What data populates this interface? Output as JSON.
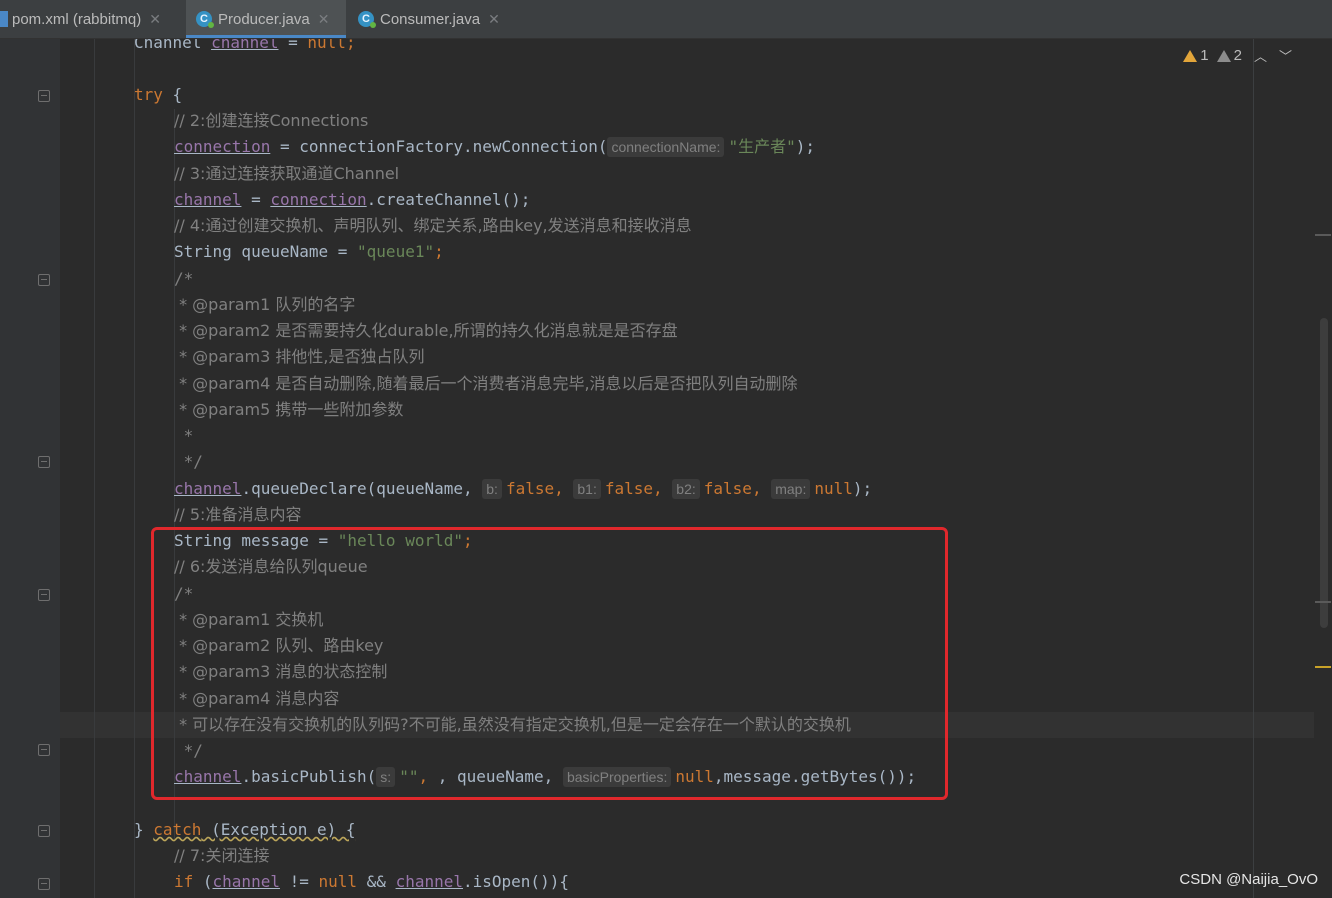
{
  "tabs": [
    {
      "label": "pom.xml (rabbitmq)"
    },
    {
      "label": "Producer.java"
    },
    {
      "label": "Consumer.java"
    }
  ],
  "inspections": {
    "warnings": "1",
    "weak_warnings": "2"
  },
  "code": {
    "l0": {
      "t1": "Channel ",
      "t2": "channel",
      "t3": " = ",
      "t4": "null",
      "t5": ";"
    },
    "l2": {
      "t1": "try",
      "t2": " {"
    },
    "l3": {
      "t1": "// 2:创建连接Connections"
    },
    "l4": {
      "t1": "connection",
      "t2": " = connectionFactory.newConnection(",
      "h1": "connectionName:",
      "t3": "\"生产者\"",
      "t4": ");"
    },
    "l5": {
      "t1": "// 3:通过连接获取通道Channel"
    },
    "l6": {
      "t1": "channel",
      "t2": " = ",
      "t3": "connection",
      "t4": ".createChannel();"
    },
    "l7": {
      "t1": "// 4:通过创建交换机、声明队列、绑定关系,路由key,发送消息和接收消息"
    },
    "l8": {
      "t1": "String queueName = ",
      "t2": "\"queue1\"",
      "t3": ";"
    },
    "l9": {
      "t1": "/*"
    },
    "l10": {
      "t1": " * @param1 队列的名字"
    },
    "l11": {
      "t1": " * @param2 是否需要持久化durable,所谓的持久化消息就是是否存盘"
    },
    "l12": {
      "t1": " * @param3 排他性,是否独占队列"
    },
    "l13": {
      "t1": " * @param4 是否自动删除,随着最后一个消费者消息完毕,消息以后是否把队列自动删除"
    },
    "l14": {
      "t1": " * @param5 携带一些附加参数"
    },
    "l15": {
      "t1": " *"
    },
    "l16": {
      "t1": " */"
    },
    "l17": {
      "t1": "channel",
      "t2": ".queueDeclare(queueName, ",
      "h1": "b:",
      "t3": "false",
      "t4": ", ",
      "h2": "b1:",
      "t5": "false",
      "t6": ", ",
      "h3": "b2:",
      "t7": "false",
      "t8": ", ",
      "h4": "map:",
      "t9": "null",
      "t10": ");"
    },
    "l18": {
      "t1": "// 5:准备消息内容"
    },
    "l19": {
      "t1": "String message = ",
      "t2": "\"hello world\"",
      "t3": ";"
    },
    "l20": {
      "t1": "// 6:发送消息给队列queue"
    },
    "l21": {
      "t1": "/*"
    },
    "l22": {
      "t1": " * @param1 交换机"
    },
    "l23": {
      "t1": " * @param2 队列、路由key"
    },
    "l24": {
      "t1": " * @param3 消息的状态控制"
    },
    "l25": {
      "t1": " * @param4 消息内容"
    },
    "l26": {
      "t1": " * 可以存在没有交换机的队列码?不可能,虽然没有指定交换机,但是一定会存在一个默认的交换机"
    },
    "l27": {
      "t1": " */"
    },
    "l28": {
      "t1": "channel",
      "t2": ".basicPublish(",
      "h1": "s:",
      "t3": "\"\"",
      "t4": ", queueName, ",
      "h2": "basicProperties:",
      "t5": "null",
      "t6": ",message.getBytes());"
    },
    "l30": {
      "t1": "} ",
      "t2": "catch",
      "t3": " (Exception e) {"
    },
    "l31": {
      "t1": "// 7:关闭连接"
    },
    "l32": {
      "t1": "if",
      "t2": " (",
      "t3": "channel",
      "t4": " != ",
      "t5": "null",
      "t6": " && ",
      "t7": "channel",
      "t8": ".isOpen()){"
    }
  },
  "watermark": "CSDN @Naijia_OvO",
  "colors": {
    "keyword": "#cc7832",
    "string": "#6a8759",
    "comment": "#808080",
    "highlight_box": "#e0282c",
    "active_tab_underline": "#4a88c7"
  }
}
